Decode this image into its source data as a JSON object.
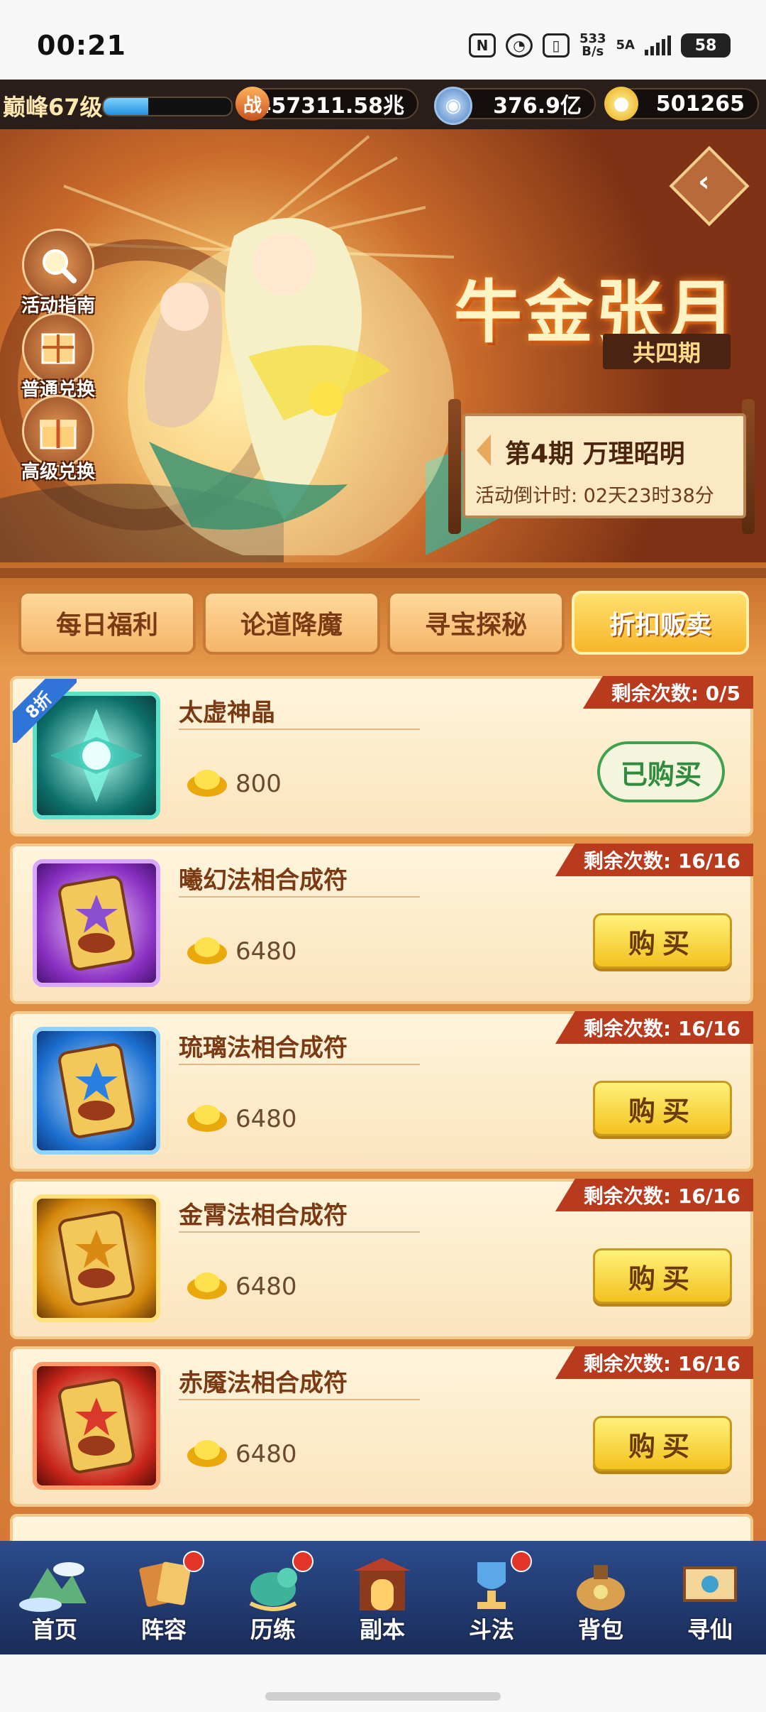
{
  "status_bar": {
    "time": "00:21",
    "net_speed_value": "533",
    "net_speed_unit": "B/s",
    "signal_label": "5A",
    "battery": "58"
  },
  "resources": {
    "level": "巅峰67级",
    "exp_progress": 0.35,
    "battle_icon": "战",
    "battle_power": "457311.58兆",
    "coins": "376.9亿",
    "ingots": "501265"
  },
  "banner": {
    "title": "牛金张月",
    "subtitle": "共四期",
    "period": "第4期  万理昭明",
    "countdown": "活动倒计时: 02天23时38分",
    "side_buttons": [
      {
        "label": "活动指南",
        "icon": "search-icon"
      },
      {
        "label": "普通兑换",
        "icon": "gift-box-icon"
      },
      {
        "label": "高级兑换",
        "icon": "gift-icon"
      }
    ]
  },
  "tabs": [
    {
      "label": "每日福利",
      "active": false
    },
    {
      "label": "论道降魔",
      "active": false
    },
    {
      "label": "寻宝探秘",
      "active": false
    },
    {
      "label": "折扣贩卖",
      "active": true
    }
  ],
  "items": [
    {
      "name": "太虚神晶",
      "price": "800",
      "remain": "剩余次数: 0/5",
      "action": "已购买",
      "discount": "8折",
      "color": "#1fb3a0"
    },
    {
      "name": "曦幻法相合成符",
      "price": "6480",
      "remain": "剩余次数: 16/16",
      "action": "购买",
      "color": "#a84fd8"
    },
    {
      "name": "琉璃法相合成符",
      "price": "6480",
      "remain": "剩余次数: 16/16",
      "action": "购买",
      "color": "#2a8ce0"
    },
    {
      "name": "金霄法相合成符",
      "price": "6480",
      "remain": "剩余次数: 16/16",
      "action": "购买",
      "color": "#e6a21a"
    },
    {
      "name": "赤魇法相合成符",
      "price": "6480",
      "remain": "剩余次数: 16/16",
      "action": "购买",
      "color": "#d8392a"
    }
  ],
  "nav": [
    {
      "label": "首页",
      "icon": "home-icon",
      "dot": false
    },
    {
      "label": "阵容",
      "icon": "cards-icon",
      "dot": true
    },
    {
      "label": "历练",
      "icon": "dragon-icon",
      "dot": true
    },
    {
      "label": "副本",
      "icon": "gate-icon",
      "dot": false
    },
    {
      "label": "斗法",
      "icon": "trophy-icon",
      "dot": true
    },
    {
      "label": "背包",
      "icon": "bag-icon",
      "dot": false
    },
    {
      "label": "寻仙",
      "icon": "scroll-icon",
      "dot": false
    }
  ]
}
